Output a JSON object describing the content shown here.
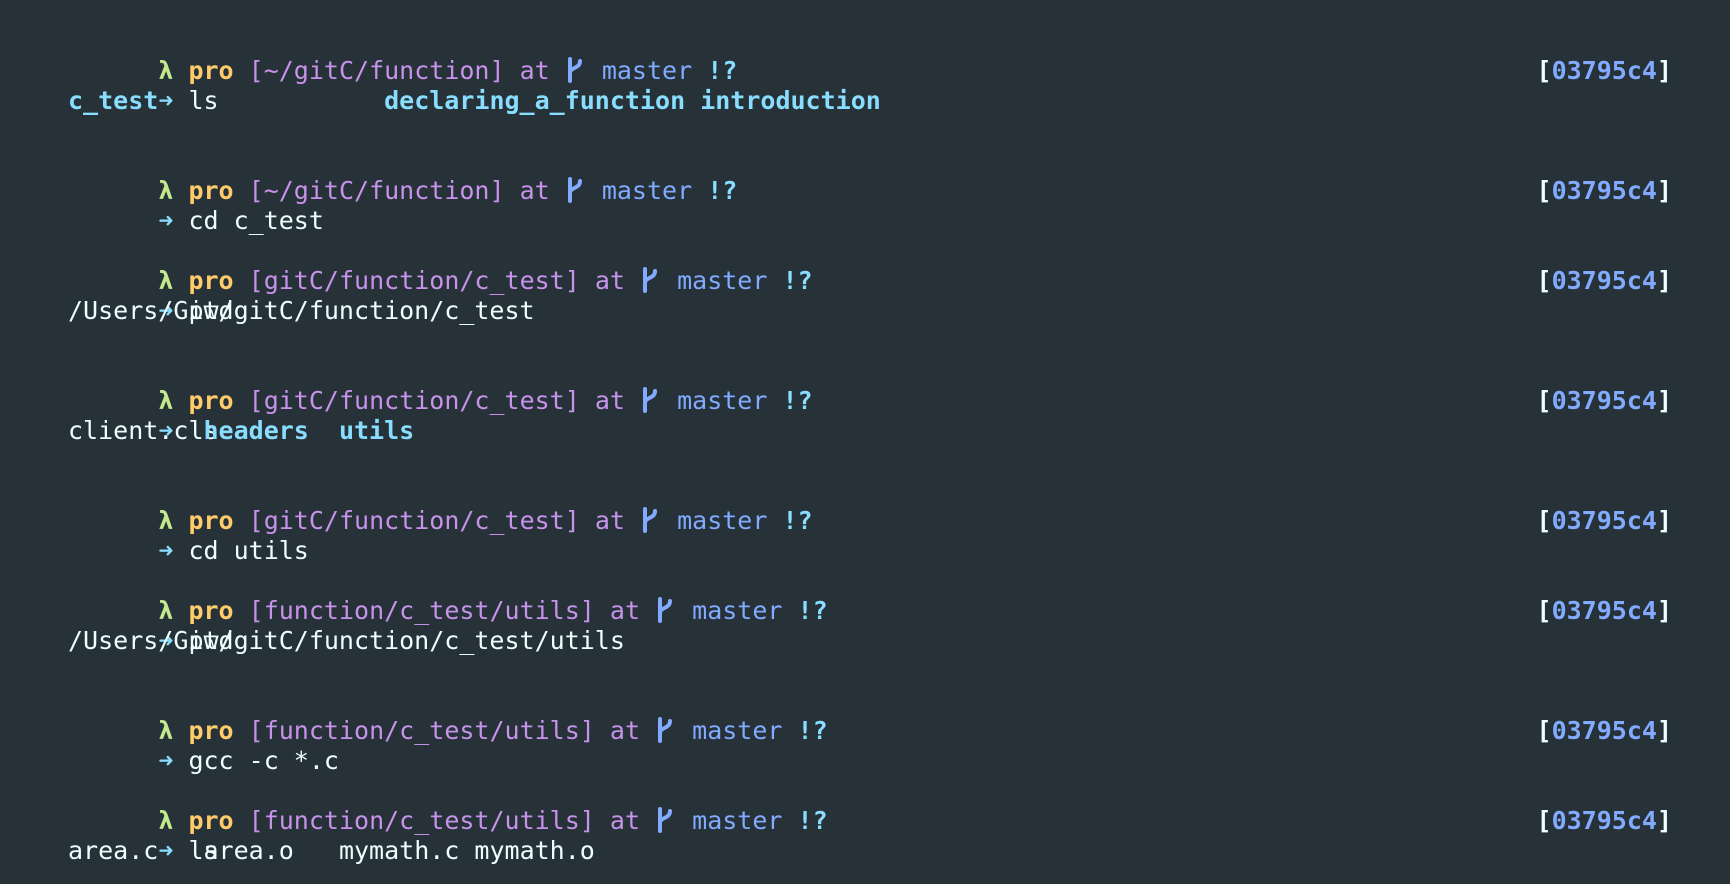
{
  "colors": {
    "background": "#263238",
    "lambda": "#c3e88d",
    "user": "#ffcb6b",
    "path": "#c792ea",
    "branch": "#82aaff",
    "status": "#89ddff",
    "directory": "#89ddff",
    "hash": "#82aaff",
    "text": "#eeffff"
  },
  "icons": {
    "branch": "git-branch-icon",
    "prompt_arrow": "right-arrow-icon"
  },
  "entries": [
    {
      "prompt": {
        "lambda": "λ",
        "user": "pro",
        "path": "[~/gitC/function]",
        "at": "at",
        "branch": "master",
        "status": "!?"
      },
      "arrow": "➜",
      "command": "ls",
      "rprompt": {
        "open": "[",
        "hash": "03795c4",
        "close": "]"
      },
      "output": [
        [
          {
            "text": "c_test",
            "type": "dir"
          },
          {
            "text": "               ",
            "type": "space"
          },
          {
            "text": "declaring_a_function",
            "type": "dir"
          },
          {
            "text": " ",
            "type": "space"
          },
          {
            "text": "introduction",
            "type": "dir"
          }
        ]
      ]
    },
    {
      "prompt": {
        "lambda": "λ",
        "user": "pro",
        "path": "[~/gitC/function]",
        "at": "at",
        "branch": "master",
        "status": "!?"
      },
      "arrow": "➜",
      "command": "cd c_test",
      "rprompt": {
        "open": "[",
        "hash": "03795c4",
        "close": "]"
      },
      "output": []
    },
    {
      "prompt": {
        "lambda": "λ",
        "user": "pro",
        "path": "[gitC/function/c_test]",
        "at": "at",
        "branch": "master",
        "status": "!?"
      },
      "arrow": "➜",
      "command": "pwd",
      "rprompt": {
        "open": "[",
        "hash": "03795c4",
        "close": "]"
      },
      "output": [
        [
          {
            "text": "/Users/Git/gitC/function/c_test",
            "type": "file"
          }
        ]
      ]
    },
    {
      "prompt": {
        "lambda": "λ",
        "user": "pro",
        "path": "[gitC/function/c_test]",
        "at": "at",
        "branch": "master",
        "status": "!?"
      },
      "arrow": "➜",
      "command": "ls",
      "rprompt": {
        "open": "[",
        "hash": "03795c4",
        "close": "]"
      },
      "output": [
        [
          {
            "text": "client.c",
            "type": "file"
          },
          {
            "text": " ",
            "type": "space"
          },
          {
            "text": "headers",
            "type": "dir"
          },
          {
            "text": "  ",
            "type": "space"
          },
          {
            "text": "utils",
            "type": "dir"
          }
        ]
      ]
    },
    {
      "prompt": {
        "lambda": "λ",
        "user": "pro",
        "path": "[gitC/function/c_test]",
        "at": "at",
        "branch": "master",
        "status": "!?"
      },
      "arrow": "➜",
      "command": "cd utils",
      "rprompt": {
        "open": "[",
        "hash": "03795c4",
        "close": "]"
      },
      "output": []
    },
    {
      "prompt": {
        "lambda": "λ",
        "user": "pro",
        "path": "[function/c_test/utils]",
        "at": "at",
        "branch": "master",
        "status": "!?"
      },
      "arrow": "➜",
      "command": "pwd",
      "rprompt": {
        "open": "[",
        "hash": "03795c4",
        "close": "]"
      },
      "output": [
        [
          {
            "text": "/Users/Git/gitC/function/c_test/utils",
            "type": "file"
          }
        ]
      ]
    },
    {
      "prompt": {
        "lambda": "λ",
        "user": "pro",
        "path": "[function/c_test/utils]",
        "at": "at",
        "branch": "master",
        "status": "!?"
      },
      "arrow": "➜",
      "command": "gcc -c *.c",
      "rprompt": {
        "open": "[",
        "hash": "03795c4",
        "close": "]"
      },
      "output": []
    },
    {
      "prompt": {
        "lambda": "λ",
        "user": "pro",
        "path": "[function/c_test/utils]",
        "at": "at",
        "branch": "master",
        "status": "!?"
      },
      "arrow": "➜",
      "command": "ls",
      "rprompt": {
        "open": "[",
        "hash": "03795c4",
        "close": "]"
      },
      "output": [
        [
          {
            "text": "area.c",
            "type": "file"
          },
          {
            "text": "   ",
            "type": "space"
          },
          {
            "text": "area.o",
            "type": "file"
          },
          {
            "text": "   ",
            "type": "space"
          },
          {
            "text": "mymath.c",
            "type": "file"
          },
          {
            "text": " ",
            "type": "space"
          },
          {
            "text": "mymath.o",
            "type": "file"
          }
        ]
      ]
    }
  ]
}
